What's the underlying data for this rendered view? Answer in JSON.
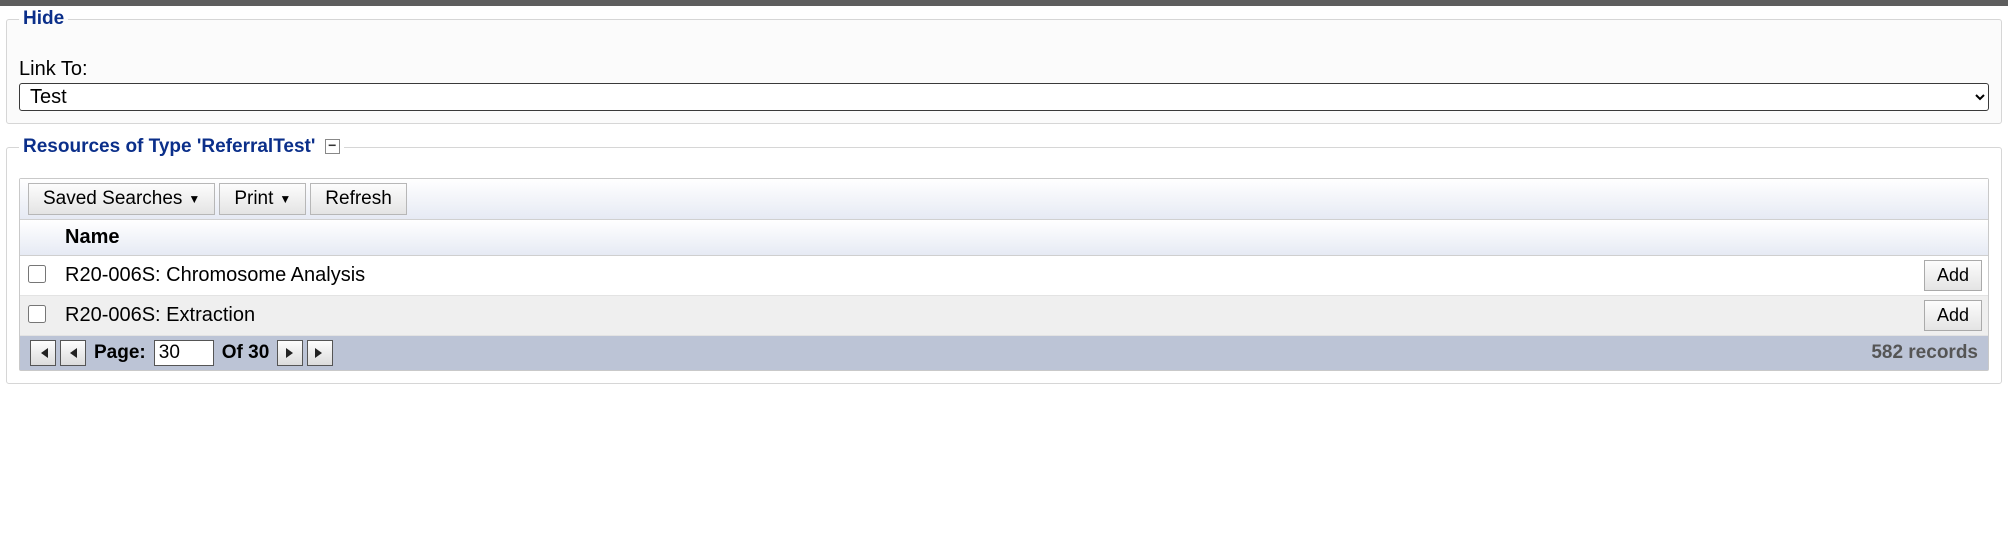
{
  "hide_panel": {
    "legend": "Hide",
    "link_to_label": "Link To:",
    "link_to_value": "Test"
  },
  "resources_panel": {
    "legend": "Resources of Type 'ReferralTest'",
    "toolbar": {
      "saved_searches": "Saved Searches",
      "print": "Print",
      "refresh": "Refresh"
    },
    "table": {
      "header_name": "Name",
      "add_label": "Add",
      "rows": [
        {
          "name": "R20-006S: Chromosome Analysis"
        },
        {
          "name": "R20-006S: Extraction"
        }
      ]
    },
    "pager": {
      "page_label": "Page:",
      "page_value": "30",
      "of_label": "Of 30",
      "records_label": "582 records"
    }
  }
}
